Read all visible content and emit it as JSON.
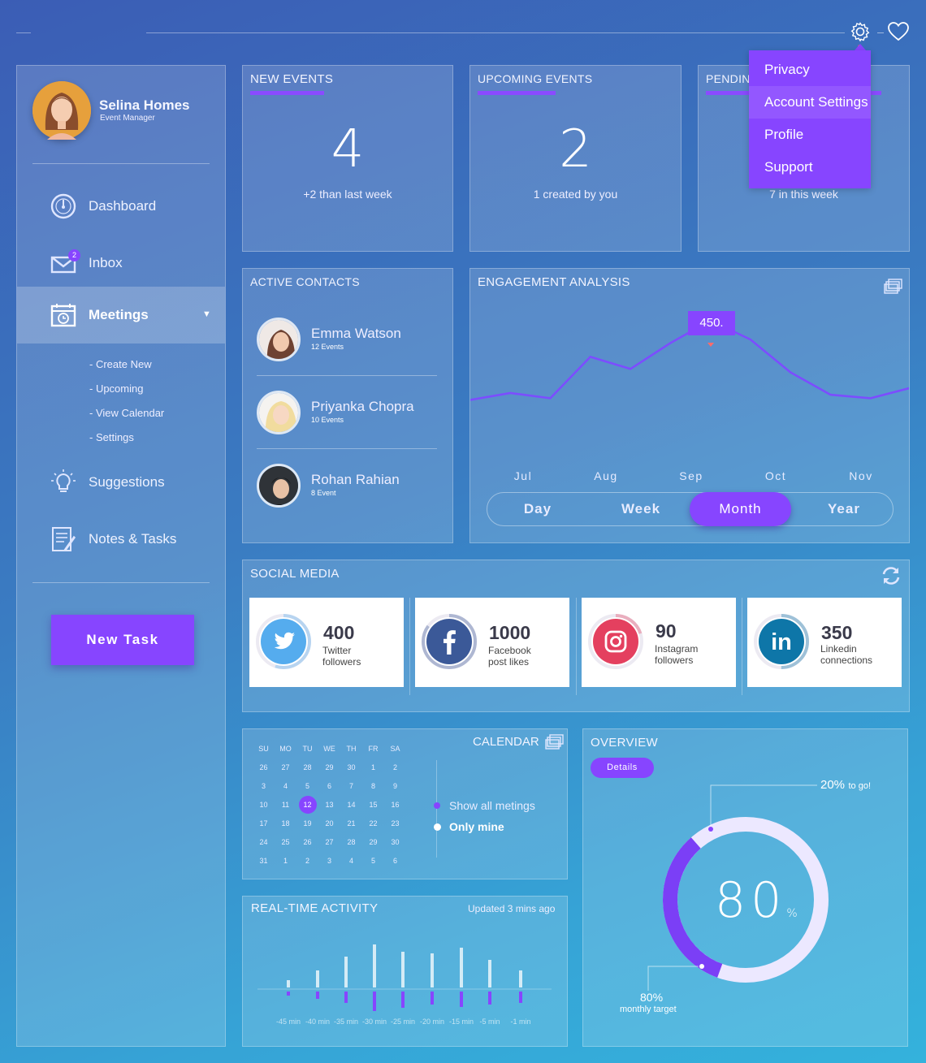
{
  "header": {
    "gear_icon": "gear-icon",
    "heart_icon": "heart-icon"
  },
  "dropdown": {
    "items": [
      "Privacy",
      "Account Settings",
      "Profile",
      "Support"
    ],
    "active_index": 1
  },
  "profile": {
    "name": "Selina Homes",
    "role": "Event Manager"
  },
  "sidebar": {
    "items": [
      {
        "label": "Dashboard",
        "icon": "gauge-icon"
      },
      {
        "label": "Inbox",
        "icon": "mail-icon",
        "badge": "2"
      },
      {
        "label": "Meetings",
        "icon": "calendar-icon",
        "active": true
      },
      {
        "label": "Suggestions",
        "icon": "bulb-icon"
      },
      {
        "label": "Notes & Tasks",
        "icon": "notes-icon"
      }
    ],
    "submenu": [
      "- Create New",
      "- Upcoming",
      "- View Calendar",
      "- Settings"
    ],
    "new_task": "New Task"
  },
  "stats": [
    {
      "title": "NEW EVENTS",
      "value": "4",
      "sub": "+2 than last week"
    },
    {
      "title": "UPCOMING EVENTS",
      "value": "2",
      "sub": "1 created by you"
    },
    {
      "title": "PENDIN",
      "value": "",
      "sub": "7 in this week"
    }
  ],
  "contacts": {
    "title": "ACTIVE CONTACTS",
    "items": [
      {
        "name": "Emma Watson",
        "events": "12 Events"
      },
      {
        "name": "Priyanka Chopra",
        "events": "10 Events"
      },
      {
        "name": "Rohan Rahian",
        "events": "8 Event"
      }
    ]
  },
  "engagement": {
    "title": "ENGAGEMENT ANALYSIS",
    "tooltip": "450.",
    "periods": [
      "Day",
      "Week",
      "Month",
      "Year"
    ],
    "active_period": "Month"
  },
  "chart_data": {
    "type": "line",
    "x": [
      "Jul",
      "Aug",
      "Sep",
      "Oct",
      "Nov"
    ],
    "series": [
      {
        "values": [
          220,
          240,
          225,
          345,
          310,
          385,
          450,
          395,
          300,
          235,
          225,
          255
        ]
      }
    ],
    "highlight": {
      "value": 450,
      "label": "450."
    },
    "ylim": [
      0,
      600
    ]
  },
  "social": {
    "title": "SOCIAL MEDIA",
    "cards": [
      {
        "name": "twitter",
        "count": "400",
        "desc1": "Twitter",
        "desc2": "followers",
        "color": "#55acee",
        "fill": 0.55
      },
      {
        "name": "facebook",
        "count": "1000",
        "desc1": "Facebook",
        "desc2": "post likes",
        "color": "#3b5998",
        "fill": 0.85
      },
      {
        "name": "instagram",
        "count": "90",
        "desc1": "Instagram",
        "desc2": "followers",
        "color": "#e4405f",
        "fill": 0.2
      },
      {
        "name": "linkedin",
        "count": "350",
        "desc1": "Linkedin",
        "desc2": "connections",
        "color": "#0e76a8",
        "fill": 0.5
      }
    ]
  },
  "calendar": {
    "title": "CALENDAR",
    "days": [
      "SU",
      "MO",
      "TU",
      "WE",
      "TH",
      "FR",
      "SA"
    ],
    "weeks": [
      [
        "26",
        "27",
        "28",
        "29",
        "30",
        "1",
        "2"
      ],
      [
        "3",
        "4",
        "5",
        "6",
        "7",
        "8",
        "9"
      ],
      [
        "10",
        "11",
        "12",
        "13",
        "14",
        "15",
        "16"
      ],
      [
        "17",
        "18",
        "19",
        "20",
        "21",
        "22",
        "23"
      ],
      [
        "24",
        "25",
        "26",
        "27",
        "28",
        "29",
        "30"
      ],
      [
        "31",
        "1",
        "2",
        "3",
        "4",
        "5",
        "6"
      ]
    ],
    "selected": "12",
    "options": [
      "Show all metings",
      "Only mine"
    ],
    "active_option": "Only mine"
  },
  "overview": {
    "title": "OVERVIEW",
    "details": "Details",
    "percent": "80",
    "percent_sign": "%",
    "togo_pct": "20%",
    "togo_txt": "to go!",
    "target_pct": "80%",
    "target_txt": "monthly target",
    "fill": 0.8
  },
  "activity": {
    "title": "REAL-TIME ACTIVITY",
    "updated": "Updated 3 mins ago",
    "labels": [
      "-45 min",
      "-40 min",
      "-35 min",
      "-30 min",
      "-25 min",
      "-20 min",
      "-15 min",
      "-5 min",
      "-1 min"
    ],
    "up": [
      9,
      21,
      38,
      53,
      44,
      42,
      49,
      34,
      21
    ],
    "down": [
      5,
      9,
      14,
      24,
      20,
      16,
      19,
      16,
      14
    ]
  }
}
